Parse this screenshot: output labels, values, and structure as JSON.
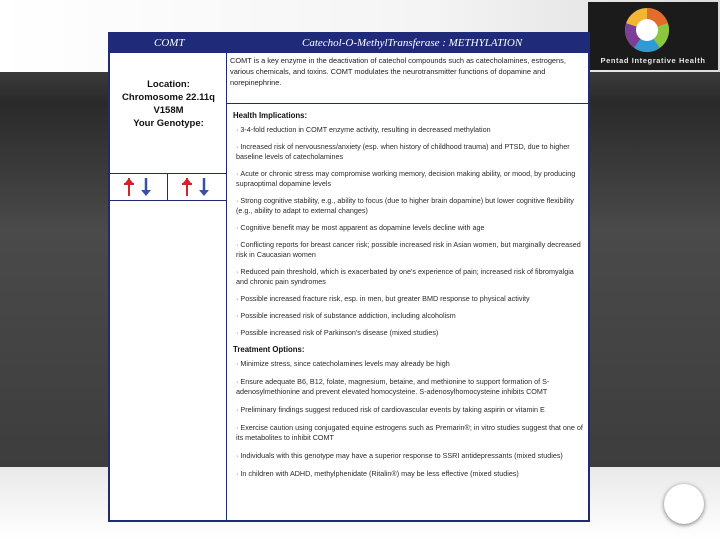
{
  "logo": {
    "brand": "Pentad Integrative Health"
  },
  "card": {
    "gene": "COMT",
    "gene_full": "Catechol-O-MethylTransferase : METHYLATION",
    "location_label": "Location:",
    "chromosome": "Chromosome 22.11q",
    "variant": "V158M",
    "genotype_label": "Your Genotype:",
    "intro": "COMT is a key enzyme in the deactivation of catechol compounds such as catecholamines, estrogens, various chemicals, and toxins. COMT modulates the neurotransmitter functions of dopamine and norepinephrine.",
    "health_title": "Health Implications:",
    "health": [
      "3-4-fold reduction in COMT enzyme activity, resulting in decreased methylation",
      "Increased risk of nervousness/anxiety (esp. when history of childhood trauma) and PTSD, due to higher baseline levels of catecholamines",
      "Acute or chronic stress may compromise working memory, decision making ability, or mood, by producing supraoptimal dopamine levels",
      "Strong cognitive stability, e.g., ability to focus (due to higher brain dopamine) but lower cognitive flexibility (e.g., ability to adapt to external changes)",
      "Cognitive benefit may be most apparent as dopamine levels decline with age",
      "Conflicting reports for breast cancer risk; possible increased risk in Asian women, but marginally decreased risk in Caucasian women",
      "Reduced pain threshold, which is exacerbated by one's experience of pain; increased risk of fibromyalgia and chronic pain syndromes",
      "Possible increased fracture risk, esp. in men, but greater BMD response to physical activity",
      "Possible increased risk of substance addiction, including alcoholism",
      "Possible increased risk of Parkinson's disease (mixed studies)"
    ],
    "treatment_title": "Treatment Options:",
    "treatment": [
      "Minimize stress, since catecholamines levels may already be high",
      "Ensure adequate B6, B12, folate, magnesium, betaine, and methionine to support formation of S-adenosylmethionine and prevent elevated homocysteine. S-adenosylhomocysteine inhibits COMT",
      "Preliminary findings suggest reduced risk of cardiovascular events by taking aspirin or vitamin E",
      "Exercise caution using conjugated equine estrogens such as Premarin®; in vitro studies suggest that one of its metabolites to inhibit COMT",
      "Individuals with this genotype may have a superior response to SSRI antidepressants (mixed studies)",
      "In children with ADHD, methylphenidate (Ritalin®) may be less effective (mixed studies)"
    ]
  },
  "colors": {
    "header_navy": "#1f2a78",
    "allele_red": "#d2232a",
    "allele_blue": "#3a4fa8"
  }
}
